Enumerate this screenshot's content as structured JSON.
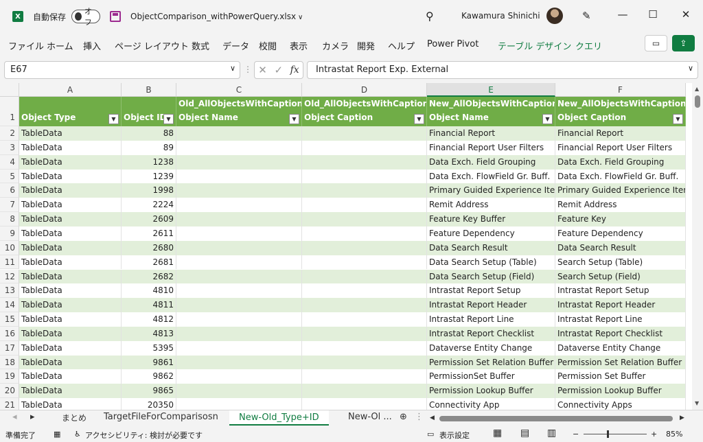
{
  "titlebar": {
    "autosave_label": "自動保存",
    "toggle_label": "オフ",
    "filename": "ObjectComparison_withPowerQuery.xlsx",
    "username": "Kawamura Shinichi"
  },
  "ribbon": {
    "tabs": [
      "ファイル",
      "ホーム",
      "挿入",
      "ページ レイアウト",
      "数式",
      "データ",
      "校閲",
      "表示",
      "カメラ",
      "開発",
      "ヘルプ",
      "Power Pivot",
      "テーブル デザイン",
      "クエリ"
    ]
  },
  "formula_bar": {
    "name_box": "E67",
    "formula": "Intrastat Report Exp. External",
    "fx_label": "fx"
  },
  "columns": [
    "A",
    "B",
    "C",
    "D",
    "E",
    "F"
  ],
  "table": {
    "headers": [
      {
        "line1": "",
        "line2": "Object Type"
      },
      {
        "line1": "",
        "line2": "Object ID"
      },
      {
        "line1": "Old_AllObjectsWithCaption.",
        "line2": "Object Name"
      },
      {
        "line1": "Old_AllObjectsWithCaption.",
        "line2": "Object Caption"
      },
      {
        "line1": "New_AllObjectsWithCaption.",
        "line2": "Object Name"
      },
      {
        "line1": "New_AllObjectsWithCaption.",
        "line2": "Object Caption"
      }
    ],
    "rows": [
      {
        "num": "2",
        "type": "TableData",
        "id": "88",
        "new_name": "Financial Report",
        "new_caption": "Financial Report"
      },
      {
        "num": "3",
        "type": "TableData",
        "id": "89",
        "new_name": "Financial Report User Filters",
        "new_caption": "Financial Report User Filters"
      },
      {
        "num": "4",
        "type": "TableData",
        "id": "1238",
        "new_name": "Data Exch. Field Grouping",
        "new_caption": "Data Exch. Field Grouping"
      },
      {
        "num": "5",
        "type": "TableData",
        "id": "1239",
        "new_name": "Data Exch. FlowField Gr. Buff.",
        "new_caption": "Data Exch. FlowField Gr. Buff."
      },
      {
        "num": "6",
        "type": "TableData",
        "id": "1998",
        "new_name": "Primary Guided Experience Item",
        "new_caption": "Primary Guided Experience Item"
      },
      {
        "num": "7",
        "type": "TableData",
        "id": "2224",
        "new_name": "Remit Address",
        "new_caption": "Remit Address"
      },
      {
        "num": "8",
        "type": "TableData",
        "id": "2609",
        "new_name": "Feature Key Buffer",
        "new_caption": "Feature Key"
      },
      {
        "num": "9",
        "type": "TableData",
        "id": "2611",
        "new_name": "Feature Dependency",
        "new_caption": "Feature Dependency"
      },
      {
        "num": "10",
        "type": "TableData",
        "id": "2680",
        "new_name": "Data Search Result",
        "new_caption": "Data Search Result"
      },
      {
        "num": "11",
        "type": "TableData",
        "id": "2681",
        "new_name": "Data Search Setup (Table)",
        "new_caption": "Search Setup (Table)"
      },
      {
        "num": "12",
        "type": "TableData",
        "id": "2682",
        "new_name": "Data Search Setup (Field)",
        "new_caption": "Search Setup (Field)"
      },
      {
        "num": "13",
        "type": "TableData",
        "id": "4810",
        "new_name": "Intrastat Report Setup",
        "new_caption": "Intrastat Report Setup"
      },
      {
        "num": "14",
        "type": "TableData",
        "id": "4811",
        "new_name": "Intrastat Report Header",
        "new_caption": "Intrastat Report Header"
      },
      {
        "num": "15",
        "type": "TableData",
        "id": "4812",
        "new_name": "Intrastat Report Line",
        "new_caption": "Intrastat Report Line"
      },
      {
        "num": "16",
        "type": "TableData",
        "id": "4813",
        "new_name": "Intrastat Report Checklist",
        "new_caption": "Intrastat Report Checklist"
      },
      {
        "num": "17",
        "type": "TableData",
        "id": "5395",
        "new_name": "Dataverse Entity Change",
        "new_caption": "Dataverse Entity Change"
      },
      {
        "num": "18",
        "type": "TableData",
        "id": "9861",
        "new_name": "Permission Set Relation Buffer",
        "new_caption": "Permission Set Relation Buffer"
      },
      {
        "num": "19",
        "type": "TableData",
        "id": "9862",
        "new_name": "PermissionSet Buffer",
        "new_caption": "Permission Set Buffer"
      },
      {
        "num": "20",
        "type": "TableData",
        "id": "9865",
        "new_name": "Permission Lookup Buffer",
        "new_caption": "Permission Lookup Buffer"
      },
      {
        "num": "21",
        "type": "TableData",
        "id": "20350",
        "new_name": "Connectivity App",
        "new_caption": "Connectivity Apps"
      }
    ]
  },
  "sheet_tabs": [
    "まとめ",
    "TargetFileForComparisosn",
    "New-Old_Type+ID",
    "New-Ol ..."
  ],
  "status": {
    "ready": "準備完了",
    "accessibility": "アクセシビリティ: 検討が必要です",
    "display_settings": "表示設定",
    "zoom": "85%"
  },
  "colors": {
    "table_header": "#70ad47",
    "band": "#e2efda",
    "accent": "#107c41"
  },
  "icons": [
    "excel-logo-icon",
    "save-icon",
    "search-icon",
    "pen-icon",
    "minimize-icon",
    "maximize-icon",
    "close-icon",
    "comment-icon",
    "share-icon"
  ]
}
